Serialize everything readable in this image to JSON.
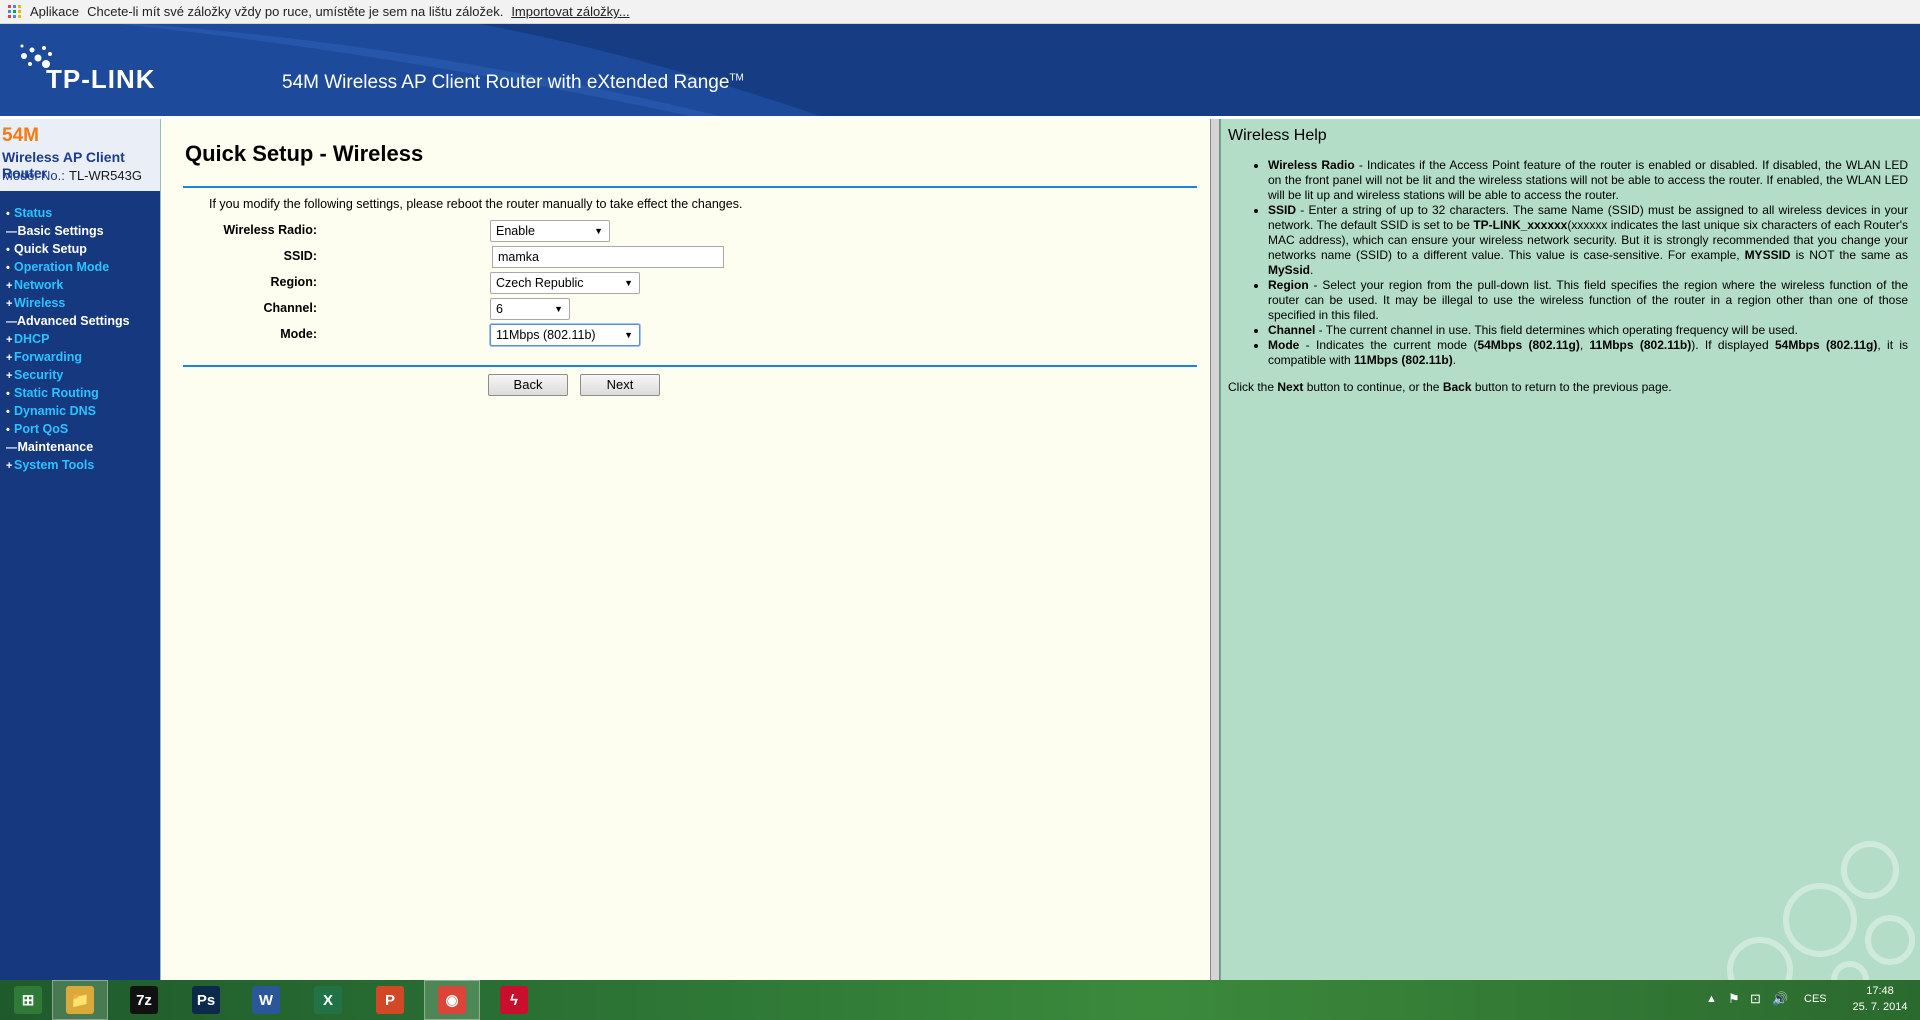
{
  "bookmarks_bar": {
    "apps_label": "Aplikace",
    "prompt": "Chcete-li mít své záložky vždy po ruce, umístěte je sem na lištu záložek.",
    "import_link": "Importovat záložky..."
  },
  "header": {
    "logo": "TP-LINK",
    "title": "54M Wireless AP Client Router with eXtended Range",
    "trademark": "TM"
  },
  "menu": {
    "badge": "54M",
    "product": "Wireless AP Client Router",
    "model_label": "Model No.:",
    "model": "TL-WR543G",
    "items": [
      {
        "label": "Status",
        "bullet": "•"
      },
      {
        "label": "Basic Settings",
        "bullet": "—",
        "section": true
      },
      {
        "label": "Quick Setup",
        "bullet": "•",
        "active": true
      },
      {
        "label": "Operation Mode",
        "bullet": "•"
      },
      {
        "label": "Network",
        "bullet": "+"
      },
      {
        "label": "Wireless",
        "bullet": "+"
      },
      {
        "label": "Advanced Settings",
        "bullet": "—",
        "section": true
      },
      {
        "label": "DHCP",
        "bullet": "+"
      },
      {
        "label": "Forwarding",
        "bullet": "+"
      },
      {
        "label": "Security",
        "bullet": "+"
      },
      {
        "label": "Static Routing",
        "bullet": "•"
      },
      {
        "label": "Dynamic DNS",
        "bullet": "•"
      },
      {
        "label": "Port QoS",
        "bullet": "•"
      },
      {
        "label": "Maintenance",
        "bullet": "—",
        "section": true
      },
      {
        "label": "System Tools",
        "bullet": "+"
      }
    ]
  },
  "main": {
    "title": "Quick Setup - Wireless",
    "notice": "If you modify the following settings, please reboot the router manually to take effect the changes.",
    "fields": {
      "radio": {
        "label": "Wireless Radio:",
        "value": "Enable"
      },
      "ssid": {
        "label": "SSID:",
        "value": "mamka"
      },
      "region": {
        "label": "Region:",
        "value": "Czech Republic"
      },
      "channel": {
        "label": "Channel:",
        "value": "6"
      },
      "mode": {
        "label": "Mode:",
        "value": "11Mbps (802.11b)"
      }
    },
    "back_label": "Back",
    "next_label": "Next"
  },
  "help": {
    "title": "Wireless Help",
    "radio_term": "Wireless Radio",
    "radio_text": " - Indicates if the Access Point feature of the router is enabled or disabled. If disabled, the WLAN LED on the front panel will not be lit and the wireless stations will not be able to access the router. If enabled, the WLAN LED will be lit up and wireless stations will be able to access the router.",
    "ssid_term": "SSID",
    "ssid_text_1": " - Enter a string of up to 32 characters. The same Name (SSID) must be assigned to all wireless devices in your network. The default SSID is set to be ",
    "ssid_default": "TP-LINK_xxxxxx",
    "ssid_text_2": "(xxxxxx indicates the last unique six characters of each Router's MAC address), which can ensure your wireless network security. But it is strongly recommended that you change your networks name (SSID) to a different value. This value is case-sensitive. For example, ",
    "ssid_example_1": "MYSSID",
    "ssid_text_3": " is NOT the same as ",
    "ssid_example_2": "MySsid",
    "ssid_text_4": ".",
    "region_term": "Region",
    "region_text": " - Select your region from the pull-down list. This field specifies the region where the wireless function of the router can be used. It may be illegal to use the wireless function of the router in a region other than one of those specified in this filed.",
    "channel_term": "Channel",
    "channel_text": " - The current channel in use. This field determines which operating frequency will be used.",
    "mode_term": "Mode",
    "mode_text_1": " - Indicates the current mode (",
    "mode_g": "54Mbps (802.11g)",
    "mode_text_2": ", ",
    "mode_b": "11Mbps (802.11b)",
    "mode_text_3": "). If displayed ",
    "mode_g2": "54Mbps (802.11g)",
    "mode_text_4": ", it is compatible with ",
    "mode_b2": "11Mbps (802.11b)",
    "mode_text_5": ".",
    "foot_1": "Click the ",
    "foot_next": "Next",
    "foot_2": " button to continue, or the ",
    "foot_back": "Back",
    "foot_3": " button to return to the previous page."
  },
  "taskbar": {
    "apps": [
      {
        "name": "start-button",
        "glyph": "⊞",
        "color": "#2f7a36"
      },
      {
        "name": "explorer",
        "glyph": "📁",
        "color": "#d9a93a"
      },
      {
        "name": "7zip",
        "glyph": "7z",
        "color": "#111111"
      },
      {
        "name": "photoshop",
        "glyph": "Ps",
        "color": "#0b2a4a"
      },
      {
        "name": "word",
        "glyph": "W",
        "color": "#2b579a"
      },
      {
        "name": "excel",
        "glyph": "X",
        "color": "#217346"
      },
      {
        "name": "powerpoint",
        "glyph": "P",
        "color": "#d24726"
      },
      {
        "name": "chrome",
        "glyph": "◉",
        "color": "#db4437"
      },
      {
        "name": "flash",
        "glyph": "ϟ",
        "color": "#c8102e"
      }
    ],
    "language": "CES",
    "time": "17:48",
    "date": "25. 7. 2014"
  }
}
